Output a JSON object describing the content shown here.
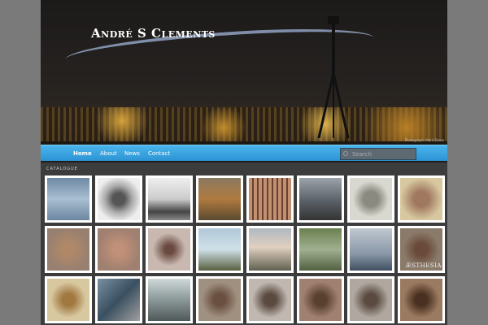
{
  "site_title": "André S Clements",
  "photo_credit": "Photograph: Mark Stone",
  "nav": [
    {
      "label": "Home"
    },
    {
      "label": "About"
    },
    {
      "label": "News"
    },
    {
      "label": "Contact"
    }
  ],
  "search": {
    "placeholder": "Search"
  },
  "section_label": "CATALOGUE",
  "thumb_text": "ÆSTHESIA",
  "thumbs": [
    "linear-gradient(#6f8aa4,#a9bfd3,#6c86a0)",
    "radial-gradient(#555 20%,#aaa 45%,#eee 75%)",
    "linear-gradient(#eee,#ccc 50%,#444 80%,#888)",
    "linear-gradient(#8a7a60,#b07a40 50%,#5a4a30)",
    "repeating-linear-gradient(90deg,#c09070 0 4px,#6a4030 4px 6px)",
    "linear-gradient(#9aa2aa,#5a6068 55%,#333)",
    "radial-gradient(#8a8a80 25%,#d8d8d0 60%)",
    "radial-gradient(#a07860 25%,#d8c8a0 70%)",
    "radial-gradient(#b08868 20%,#988070 70%)",
    "radial-gradient(#c09078 20%,#a08070 70%)",
    "radial-gradient(#6a4a40 15%,#c8b8b0 55%)",
    "linear-gradient(#b0c8d8,#d0e0e8 50%,#586040)",
    "linear-gradient(#b0b8c0,#e0d0c0 45%,#606050)",
    "linear-gradient(#6a8050,#a0b090 50%,#506040)",
    "linear-gradient(#c0c8d0,#8a98a8 60%,#405060)",
    "radial-gradient(#6a4a3a 20%,#8a7a6a 60%)",
    "radial-gradient(#a07840 20%,#d8c8a0 60%)",
    "linear-gradient(135deg,#7a90a0,#3a5060,#a0a0a0)",
    "linear-gradient(#d0d8d8,#8a9898 50%,#505858)",
    "radial-gradient(#6a5040 20%,#a09080 60%)",
    "radial-gradient(#5a4a40 20%,#c0b8b0 60%)",
    "radial-gradient(#5a4030 20%,#a08070 60%)",
    "radial-gradient(#5a4a40 20%,#b0a8a0 60%)",
    "radial-gradient(#4a3020 20%,#9a7a60 60%)"
  ]
}
